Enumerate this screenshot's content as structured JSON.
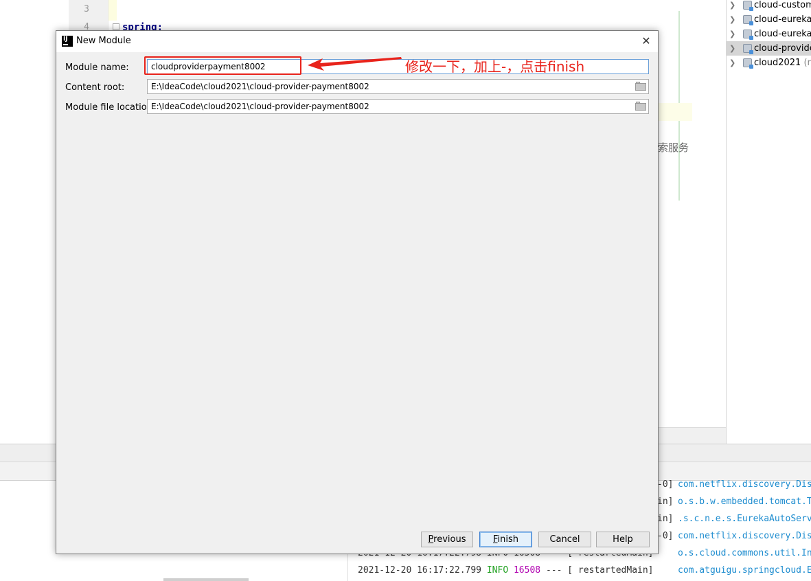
{
  "editor": {
    "line_numbers": [
      "3",
      "4"
    ],
    "code_line": "spring:",
    "snippet_text": "索服务"
  },
  "project_tree": {
    "items": [
      {
        "label": "cloud-custome",
        "muted": "",
        "selected": false
      },
      {
        "label": "cloud-eureka-",
        "muted": "",
        "selected": false
      },
      {
        "label": "cloud-eureka-",
        "muted": "",
        "selected": false
      },
      {
        "label": "cloud-provide",
        "muted": "",
        "selected": true
      },
      {
        "label": "cloud2021",
        "muted": "(roo",
        "selected": false
      }
    ]
  },
  "console": {
    "lines": [
      {
        "left": "",
        "tail": "-0]",
        "class": "com.netflix.discovery.Dis"
      },
      {
        "left": "",
        "tail": "in]",
        "class": "o.s.b.w.embedded.tomcat.T"
      },
      {
        "left": "",
        "tail": "in]",
        "class": ".s.c.n.e.s.EurekaAutoServ"
      },
      {
        "left": "",
        "tail": "-0]",
        "class": "com.netflix.discovery.Dis"
      },
      {
        "left": "2021-12-20 16:17:22.798  INFO 16508 ---  [  restartedMain]",
        "tail": "",
        "class": "o.s.cloud.commons.util.In"
      },
      {
        "date": "2021-12-20 16:17:22.799",
        "level": "INFO",
        "pid": "16508",
        "sep": "--- [",
        "thread": "restartedMain]",
        "class": "com.atguigu.springcloud.E"
      }
    ]
  },
  "dialog": {
    "title": "New Module",
    "close": "✕",
    "module_name_label": "Module name:",
    "module_name_value": "cloudproviderpayment8002",
    "content_root_label": "Content root:",
    "content_root_value": "E:\\IdeaCode\\cloud2021\\cloud-provider-payment8002",
    "module_file_label": "Module file location:",
    "module_file_value": "E:\\IdeaCode\\cloud2021\\cloud-provider-payment8002",
    "annotation": "修改一下，加上-，点击finish",
    "buttons": {
      "previous": {
        "mnemonic": "P",
        "rest": "revious"
      },
      "finish": {
        "mnemonic": "F",
        "rest": "inish"
      },
      "cancel": "Cancel",
      "help": "Help"
    }
  },
  "colors": {
    "annotation_red": "#e8231b",
    "log_info_green": "#20a020",
    "log_pid_magenta": "#b000b0",
    "log_class_blue": "#1d8ccf"
  }
}
